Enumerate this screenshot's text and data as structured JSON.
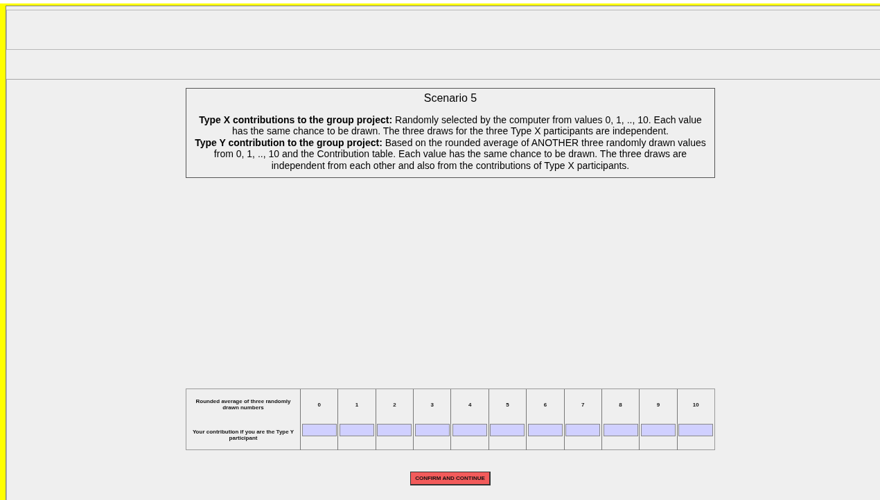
{
  "scenario": {
    "title": "Scenario 5",
    "paragraphs": [
      "**Type X contributions to the group project:** Randomly selected by the computer from values 0, 1, .., 10. Each value has the same chance to be drawn. The three draws for the three Type X participants are independent.",
      "**Type Y contribution to the group project:** Based on the rounded average of ANOTHER three randomly drawn values from 0, 1, .., 10 and the Contribution table. Each value has the same chance to be drawn. The three draws are independent from each other and also from the contributions of Type X participants."
    ]
  },
  "contribution_table": {
    "header_label": "Rounded average of three randomly drawn numbers",
    "input_label": "Your contribution if you are the Type Y participant",
    "values": [
      "0",
      "1",
      "2",
      "3",
      "4",
      "5",
      "6",
      "7",
      "8",
      "9",
      "10"
    ]
  },
  "button": "CONFIRM AND CONTINUE"
}
